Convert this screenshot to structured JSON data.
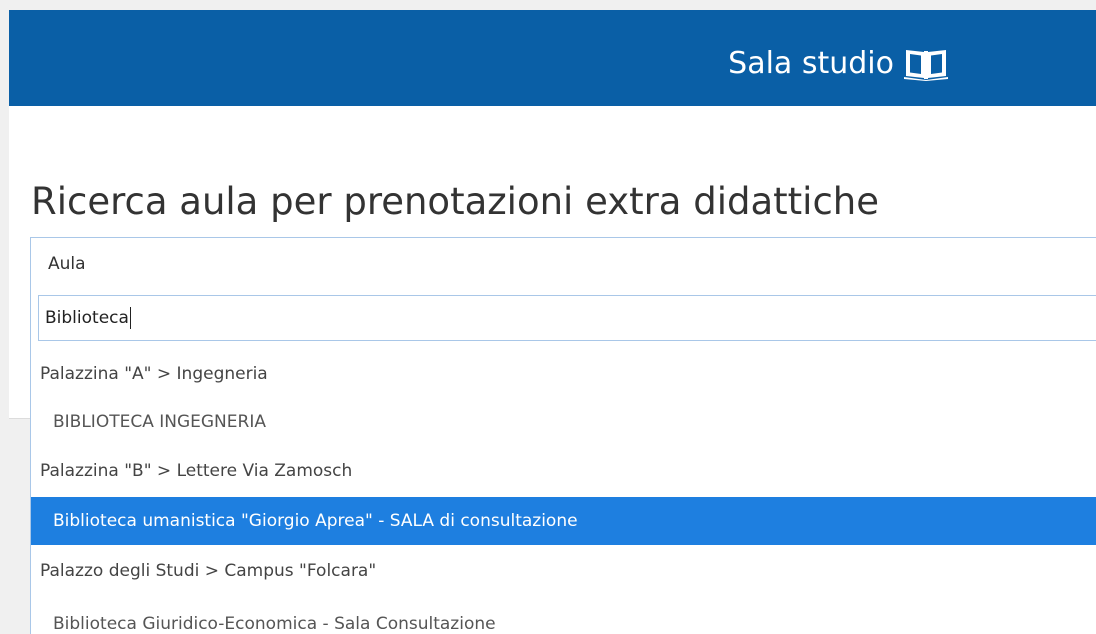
{
  "header": {
    "title": "Sala studio",
    "icon": "book-icon",
    "background_color": "#0a5fa6"
  },
  "main": {
    "heading": "Ricerca aula per prenotazioni extra didattiche"
  },
  "select": {
    "label": "Aula"
  },
  "search": {
    "value": "Biblioteca"
  },
  "dropdown": {
    "options": [
      {
        "type": "group",
        "label": "Palazzina \"A\" > Ingegneria"
      },
      {
        "type": "item",
        "label": "BIBLIOTECA INGEGNERIA"
      },
      {
        "type": "group",
        "label": "Palazzina \"B\" > Lettere Via Zamosch"
      },
      {
        "type": "item",
        "label": "Biblioteca umanistica \"Giorgio Aprea\" - SALA di consultazione",
        "selected": true
      },
      {
        "type": "group",
        "label": "Palazzo degli Studi > Campus \"Folcara\""
      },
      {
        "type": "item",
        "label": "Biblioteca Giuridico-Economica - Sala Consultazione"
      }
    ],
    "highlight_color": "#1e7fe0"
  }
}
